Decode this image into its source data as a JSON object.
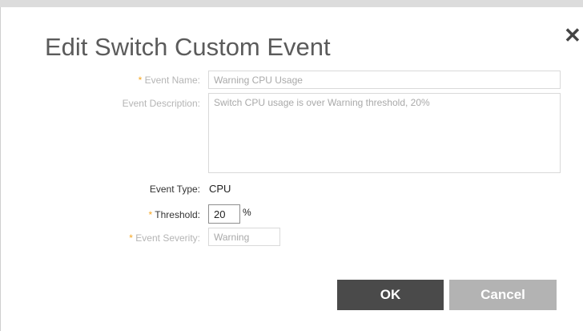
{
  "dialog": {
    "title": "Edit Switch Custom Event",
    "close_glyph": "✕"
  },
  "form": {
    "required_mark": "*",
    "event_name": {
      "label": "Event Name:",
      "value": "Warning CPU Usage"
    },
    "event_description": {
      "label": "Event Description:",
      "value": "Switch CPU usage is over Warning threshold, 20%"
    },
    "event_type": {
      "label": "Event Type:",
      "value": "CPU"
    },
    "threshold": {
      "label": "Threshold:",
      "value": "20",
      "unit": "%"
    },
    "event_severity": {
      "label": "Event Severity:",
      "value": "Warning"
    }
  },
  "buttons": {
    "ok": "OK",
    "cancel": "Cancel"
  },
  "colors": {
    "required": "#f5a623",
    "ok_button": "#4a4a4a",
    "cancel_button": "#b3b3b3"
  }
}
